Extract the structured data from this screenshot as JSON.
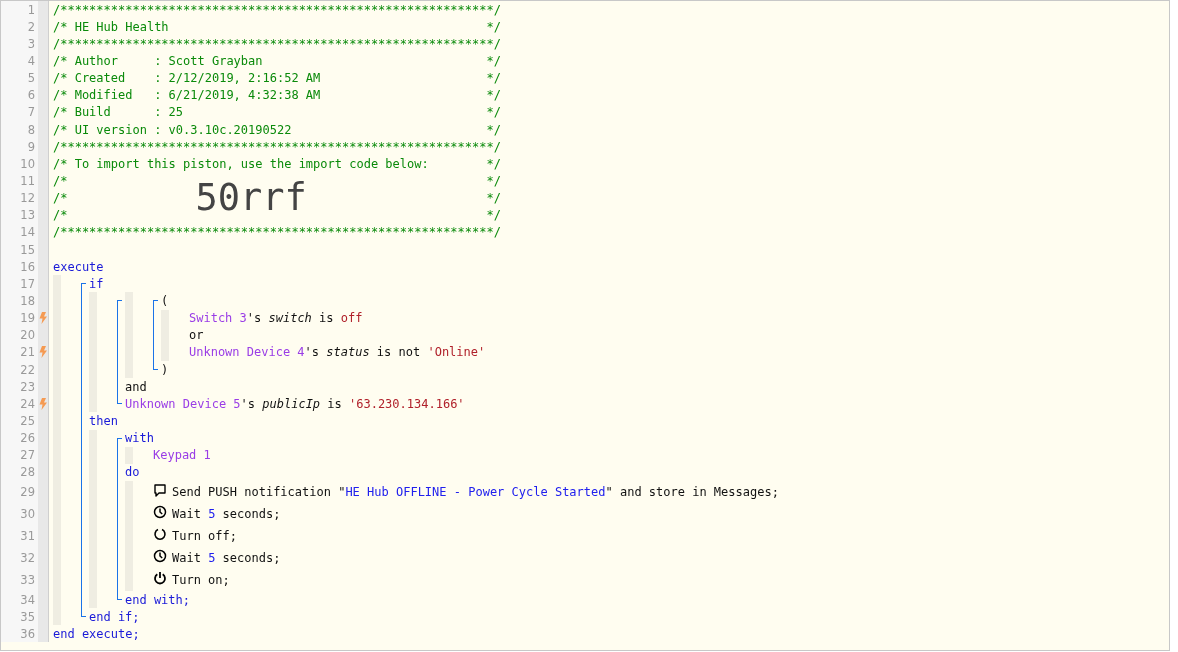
{
  "code_lines": [
    {
      "number": "1",
      "trigger": false,
      "tokens": [
        {
          "kind": "comment",
          "text": "/************************************************************/"
        }
      ]
    },
    {
      "number": "2",
      "trigger": false,
      "tokens": [
        {
          "kind": "comment",
          "text": "/* HE Hub Health"
        },
        {
          "kind": "comment-end",
          "text": "*/"
        }
      ]
    },
    {
      "number": "3",
      "trigger": false,
      "tokens": [
        {
          "kind": "comment",
          "text": "/************************************************************/"
        }
      ]
    },
    {
      "number": "4",
      "trigger": false,
      "tokens": [
        {
          "kind": "comment",
          "text": "/* Author     : Scott Grayban"
        },
        {
          "kind": "comment-end",
          "text": "*/"
        }
      ]
    },
    {
      "number": "5",
      "trigger": false,
      "tokens": [
        {
          "kind": "comment",
          "text": "/* Created    : 2/12/2019, 2:16:52 AM"
        },
        {
          "kind": "comment-end",
          "text": "*/"
        }
      ]
    },
    {
      "number": "6",
      "trigger": false,
      "tokens": [
        {
          "kind": "comment",
          "text": "/* Modified   : 6/21/2019, 4:32:38 AM"
        },
        {
          "kind": "comment-end",
          "text": "*/"
        }
      ]
    },
    {
      "number": "7",
      "trigger": false,
      "tokens": [
        {
          "kind": "comment",
          "text": "/* Build      : 25"
        },
        {
          "kind": "comment-end",
          "text": "*/"
        }
      ]
    },
    {
      "number": "8",
      "trigger": false,
      "tokens": [
        {
          "kind": "comment",
          "text": "/* UI version : v0.3.10c.20190522"
        },
        {
          "kind": "comment-end",
          "text": "*/"
        }
      ]
    },
    {
      "number": "9",
      "trigger": false,
      "tokens": [
        {
          "kind": "comment",
          "text": "/************************************************************/"
        }
      ]
    },
    {
      "number": "10",
      "trigger": false,
      "tokens": [
        {
          "kind": "comment",
          "text": "/* To import this piston, use the import code below:"
        },
        {
          "kind": "comment-end",
          "text": "*/"
        }
      ]
    },
    {
      "number": "11",
      "trigger": false,
      "tokens": [
        {
          "kind": "comment",
          "text": "/*"
        },
        {
          "kind": "comment-end",
          "text": "*/"
        }
      ]
    },
    {
      "number": "12",
      "trigger": false,
      "tokens": [
        {
          "kind": "comment",
          "text": "/*"
        },
        {
          "kind": "import-code",
          "text": "50rrf"
        },
        {
          "kind": "comment-end",
          "text": "*/"
        }
      ]
    },
    {
      "number": "13",
      "trigger": false,
      "tokens": [
        {
          "kind": "comment",
          "text": "/*"
        },
        {
          "kind": "comment-end",
          "text": "*/"
        }
      ]
    },
    {
      "number": "14",
      "trigger": false,
      "tokens": [
        {
          "kind": "comment",
          "text": "/************************************************************/"
        }
      ]
    },
    {
      "number": "15",
      "trigger": false
    },
    {
      "number": "16",
      "trigger": false,
      "tokens": [
        {
          "kind": "keyword",
          "text": "execute"
        }
      ]
    },
    {
      "number": "17",
      "trigger": false,
      "guides": [
        {
          "kind": "bar"
        },
        {
          "kind": "top"
        }
      ],
      "tokens": [
        {
          "kind": "keyword",
          "text": "if"
        }
      ]
    },
    {
      "number": "18",
      "trigger": false,
      "guides": [
        {
          "kind": "bar"
        },
        {
          "kind": "mid"
        },
        {
          "kind": "bar"
        },
        {
          "kind": "top"
        },
        {
          "kind": "bar"
        },
        {
          "kind": "top"
        }
      ],
      "tokens": [
        {
          "kind": "text",
          "text": "("
        }
      ]
    },
    {
      "number": "19",
      "trigger": true,
      "guides": [
        {
          "kind": "bar"
        },
        {
          "kind": "mid"
        },
        {
          "kind": "bar"
        },
        {
          "kind": "mid"
        },
        {
          "kind": "bar"
        },
        {
          "kind": "mid"
        },
        {
          "kind": "bar"
        }
      ],
      "tokens": [
        {
          "kind": "device",
          "text": "Switch 3"
        },
        {
          "kind": "text",
          "text": "'s "
        },
        {
          "kind": "attribute",
          "text": "switch"
        },
        {
          "kind": "text",
          "text": " is "
        },
        {
          "kind": "string",
          "text": "off"
        }
      ]
    },
    {
      "number": "20",
      "trigger": false,
      "guides": [
        {
          "kind": "bar"
        },
        {
          "kind": "mid"
        },
        {
          "kind": "bar"
        },
        {
          "kind": "mid"
        },
        {
          "kind": "bar"
        },
        {
          "kind": "mid"
        },
        {
          "kind": "bar"
        }
      ],
      "tokens": [
        {
          "kind": "text",
          "text": "or"
        }
      ]
    },
    {
      "number": "21",
      "trigger": true,
      "guides": [
        {
          "kind": "bar"
        },
        {
          "kind": "mid"
        },
        {
          "kind": "bar"
        },
        {
          "kind": "mid"
        },
        {
          "kind": "bar"
        },
        {
          "kind": "mid"
        },
        {
          "kind": "bar"
        }
      ],
      "tokens": [
        {
          "kind": "device",
          "text": "Unknown Device 4"
        },
        {
          "kind": "text",
          "text": "'s "
        },
        {
          "kind": "attribute",
          "text": "status"
        },
        {
          "kind": "text",
          "text": " is not "
        },
        {
          "kind": "string",
          "text": "'Online'"
        }
      ]
    },
    {
      "number": "22",
      "trigger": false,
      "guides": [
        {
          "kind": "bar"
        },
        {
          "kind": "mid"
        },
        {
          "kind": "bar"
        },
        {
          "kind": "mid"
        },
        {
          "kind": "bar"
        },
        {
          "kind": "end"
        }
      ],
      "tokens": [
        {
          "kind": "text",
          "text": ")"
        }
      ]
    },
    {
      "number": "23",
      "trigger": false,
      "guides": [
        {
          "kind": "bar"
        },
        {
          "kind": "mid"
        },
        {
          "kind": "bar"
        },
        {
          "kind": "mid"
        }
      ],
      "tokens": [
        {
          "kind": "text",
          "text": "and"
        }
      ]
    },
    {
      "number": "24",
      "trigger": true,
      "guides": [
        {
          "kind": "bar"
        },
        {
          "kind": "mid"
        },
        {
          "kind": "bar"
        },
        {
          "kind": "end"
        }
      ],
      "tokens": [
        {
          "kind": "device",
          "text": "Unknown Device 5"
        },
        {
          "kind": "text",
          "text": "'s "
        },
        {
          "kind": "attribute",
          "text": "publicIp"
        },
        {
          "kind": "text",
          "text": " is "
        },
        {
          "kind": "string",
          "text": "'63.230.134.166'"
        }
      ]
    },
    {
      "number": "25",
      "trigger": false,
      "guides": [
        {
          "kind": "bar"
        },
        {
          "kind": "mid"
        }
      ],
      "tokens": [
        {
          "kind": "keyword",
          "text": "then"
        }
      ]
    },
    {
      "number": "26",
      "trigger": false,
      "guides": [
        {
          "kind": "bar"
        },
        {
          "kind": "mid"
        },
        {
          "kind": "bar"
        },
        {
          "kind": "top"
        }
      ],
      "tokens": [
        {
          "kind": "keyword",
          "text": "with"
        }
      ]
    },
    {
      "number": "27",
      "trigger": false,
      "guides": [
        {
          "kind": "bar"
        },
        {
          "kind": "mid"
        },
        {
          "kind": "bar"
        },
        {
          "kind": "mid"
        },
        {
          "kind": "bar"
        }
      ],
      "tokens": [
        {
          "kind": "device",
          "text": "Keypad 1"
        }
      ]
    },
    {
      "number": "28",
      "trigger": false,
      "guides": [
        {
          "kind": "bar"
        },
        {
          "kind": "mid"
        },
        {
          "kind": "bar"
        },
        {
          "kind": "mid"
        }
      ],
      "tokens": [
        {
          "kind": "keyword",
          "text": "do"
        }
      ]
    },
    {
      "number": "29",
      "trigger": false,
      "kind": "notification",
      "guides": [
        {
          "kind": "bar"
        },
        {
          "kind": "mid"
        },
        {
          "kind": "bar"
        },
        {
          "kind": "mid"
        },
        {
          "kind": "bar"
        }
      ],
      "tokens": [
        {
          "kind": "text",
          "text": "Send PUSH notification \""
        },
        {
          "kind": "value",
          "text": "HE Hub OFFLINE - Power Cycle Started"
        },
        {
          "kind": "text",
          "text": "\" and store in Messages;"
        }
      ]
    },
    {
      "number": "30",
      "trigger": false,
      "kind": "wait",
      "guides": [
        {
          "kind": "bar"
        },
        {
          "kind": "mid"
        },
        {
          "kind": "bar"
        },
        {
          "kind": "mid"
        },
        {
          "kind": "bar"
        }
      ],
      "tokens": [
        {
          "kind": "text",
          "text": "Wait "
        },
        {
          "kind": "value",
          "text": "5"
        },
        {
          "kind": "text",
          "text": " seconds;"
        }
      ]
    },
    {
      "number": "31",
      "trigger": false,
      "kind": "off",
      "guides": [
        {
          "kind": "bar"
        },
        {
          "kind": "mid"
        },
        {
          "kind": "bar"
        },
        {
          "kind": "mid"
        },
        {
          "kind": "bar"
        }
      ],
      "tokens": [
        {
          "kind": "text",
          "text": "Turn off;"
        }
      ]
    },
    {
      "number": "32",
      "trigger": false,
      "kind": "wait",
      "guides": [
        {
          "kind": "bar"
        },
        {
          "kind": "mid"
        },
        {
          "kind": "bar"
        },
        {
          "kind": "mid"
        },
        {
          "kind": "bar"
        }
      ],
      "tokens": [
        {
          "kind": "text",
          "text": "Wait "
        },
        {
          "kind": "value",
          "text": "5"
        },
        {
          "kind": "text",
          "text": " seconds;"
        }
      ]
    },
    {
      "number": "33",
      "trigger": false,
      "kind": "on",
      "guides": [
        {
          "kind": "bar"
        },
        {
          "kind": "mid"
        },
        {
          "kind": "bar"
        },
        {
          "kind": "mid"
        },
        {
          "kind": "bar"
        }
      ],
      "tokens": [
        {
          "kind": "text",
          "text": "Turn on;"
        }
      ]
    },
    {
      "number": "34",
      "trigger": false,
      "guides": [
        {
          "kind": "bar"
        },
        {
          "kind": "mid"
        },
        {
          "kind": "bar"
        },
        {
          "kind": "end"
        }
      ],
      "tokens": [
        {
          "kind": "keyword",
          "text": "end with;"
        }
      ]
    },
    {
      "number": "35",
      "trigger": false,
      "guides": [
        {
          "kind": "bar"
        },
        {
          "kind": "end"
        }
      ],
      "tokens": [
        {
          "kind": "keyword",
          "text": "end if;"
        }
      ]
    },
    {
      "number": "36",
      "trigger": false,
      "tokens": [
        {
          "kind": "keyword",
          "text": "end execute;"
        }
      ]
    }
  ]
}
